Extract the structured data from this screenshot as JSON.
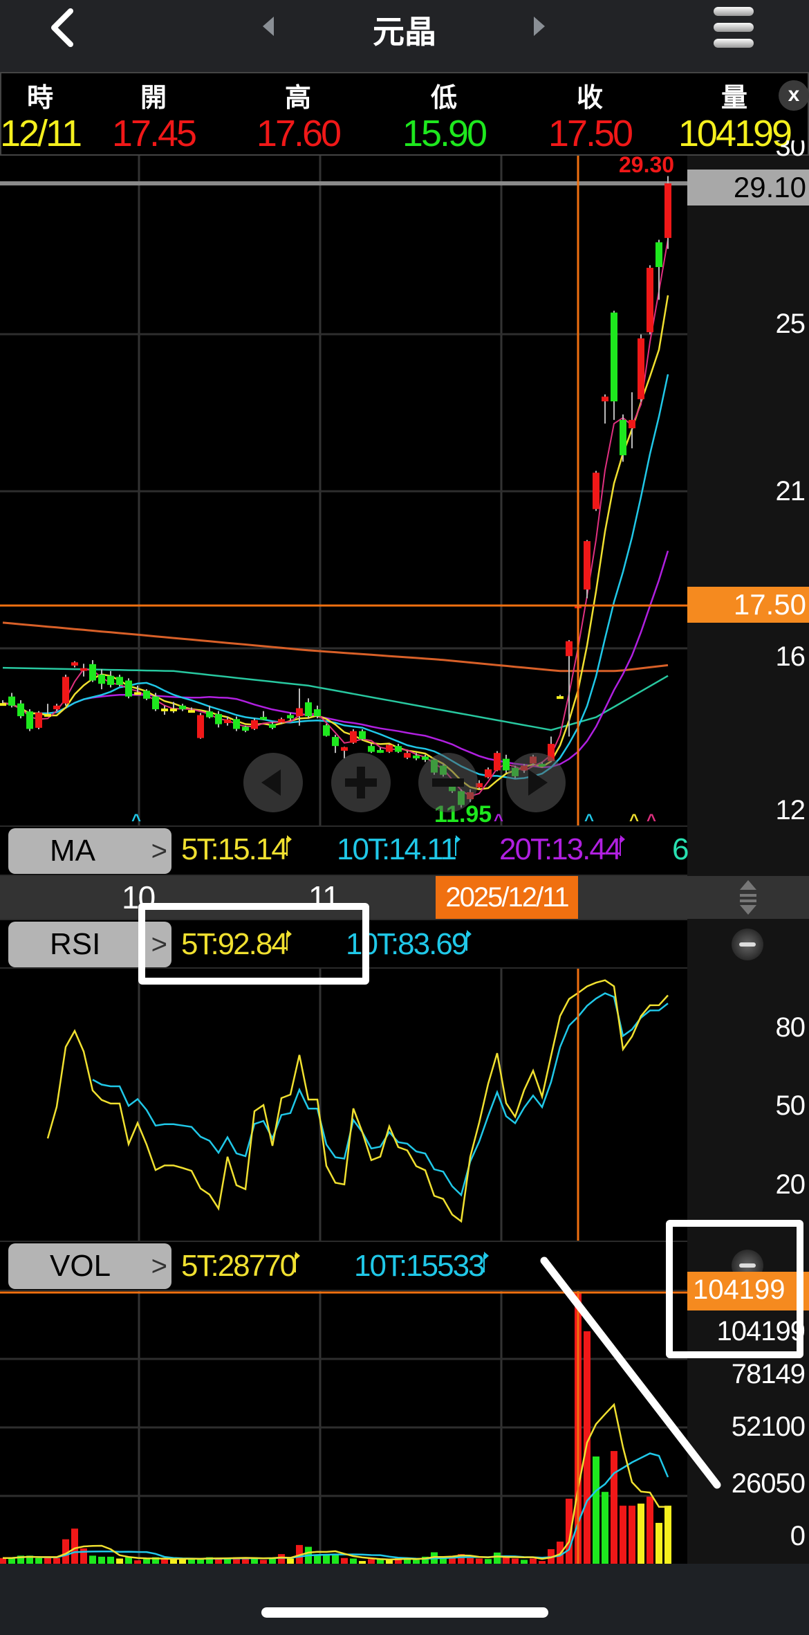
{
  "header": {
    "title": "元晶",
    "back_icon": "chevron-left-icon",
    "prev_icon": "triangle-left-icon",
    "next_icon": "triangle-right-icon",
    "menu_icon": "hamburger-icon"
  },
  "quote": {
    "columns": [
      {
        "label": "時",
        "value": "12/11",
        "color": "#f5f01e"
      },
      {
        "label": "開",
        "value": "17.45",
        "color": "#f01818"
      },
      {
        "label": "高",
        "value": "17.60",
        "color": "#f01818"
      },
      {
        "label": "低",
        "value": "15.90",
        "color": "#1ee81e"
      },
      {
        "label": "收",
        "value": "17.50",
        "color": "#f01818"
      },
      {
        "label": "量",
        "value": "104199",
        "color": "#f5f01e"
      }
    ],
    "close_label": "x"
  },
  "price_axis": {
    "top_partial": "30",
    "last_price": "29.10",
    "ticks": [
      "25",
      "21",
      "16",
      "12"
    ],
    "cursor_price": "17.50",
    "high_label": "29.30",
    "low_label": "11.95"
  },
  "ma_bar": {
    "button": "MA",
    "chevron": ">",
    "values": [
      "5T:15.14",
      "10T:14.11",
      "20T:13.44",
      "6"
    ]
  },
  "date_axis": {
    "ticks": [
      "10",
      "11"
    ],
    "cursor_date": "2025/12/11"
  },
  "rsi_bar": {
    "button": "RSI",
    "chevron": ">",
    "values": [
      "5T:92.84",
      "10T:83.69"
    ],
    "axis": [
      "80",
      "50",
      "20"
    ]
  },
  "vol_bar": {
    "button": "VOL",
    "chevron": ">",
    "values": [
      "5T:28770",
      "10T:15533"
    ],
    "cursor_value": "104199",
    "axis": [
      "104199",
      "78149",
      "52100",
      "26050",
      "0"
    ]
  },
  "colors": {
    "up": "#f01818",
    "down": "#1ee81e",
    "flat": "#f5f01e",
    "ma5": "#f0e030",
    "ma10": "#20c8e8",
    "ma20": "#b020e0",
    "ma60": "#28c8a0",
    "ma_long": "#d86028",
    "ma3": "#e03080",
    "cursor": "#f07010"
  },
  "chart_data": {
    "type": "candlestick",
    "title": "元晶",
    "cursor_index": 64,
    "ohlc": [
      [
        14.82,
        14.9,
        14.75,
        14.82
      ],
      [
        15.0,
        15.1,
        14.7,
        14.75
      ],
      [
        14.81,
        14.9,
        14.4,
        14.46
      ],
      [
        14.59,
        14.65,
        14.05,
        14.11
      ],
      [
        14.14,
        14.6,
        14.1,
        14.56
      ],
      [
        14.52,
        14.8,
        14.45,
        14.52
      ],
      [
        14.65,
        14.8,
        14.6,
        14.75
      ],
      [
        14.81,
        15.6,
        14.75,
        15.54
      ],
      [
        15.85,
        15.97,
        15.8,
        15.94
      ],
      [
        15.74,
        15.9,
        15.55,
        15.78
      ],
      [
        15.89,
        16.0,
        15.4,
        15.44
      ],
      [
        15.6,
        15.75,
        15.2,
        15.35
      ],
      [
        15.57,
        15.7,
        15.25,
        15.32
      ],
      [
        15.54,
        15.6,
        15.28,
        15.32
      ],
      [
        15.44,
        15.5,
        14.95,
        15.0
      ],
      [
        15.12,
        15.3,
        15.05,
        15.12
      ],
      [
        15.16,
        15.2,
        14.9,
        14.94
      ],
      [
        15.0,
        15.1,
        14.6,
        14.65
      ],
      [
        14.67,
        14.75,
        14.5,
        14.67
      ],
      [
        14.67,
        14.85,
        14.55,
        14.67
      ],
      [
        14.75,
        14.8,
        14.6,
        14.65
      ],
      [
        14.63,
        14.7,
        14.6,
        14.63
      ],
      [
        13.86,
        14.55,
        13.84,
        14.49
      ],
      [
        14.59,
        14.75,
        14.4,
        14.43
      ],
      [
        14.52,
        14.6,
        14.15,
        14.24
      ],
      [
        14.27,
        14.45,
        14.2,
        14.37
      ],
      [
        14.38,
        14.45,
        14.05,
        14.11
      ],
      [
        14.17,
        14.2,
        14.02,
        14.06
      ],
      [
        14.11,
        14.4,
        14.08,
        14.35
      ],
      [
        14.44,
        14.6,
        14.35,
        14.38
      ],
      [
        14.24,
        14.3,
        14.1,
        14.14
      ],
      [
        14.29,
        14.42,
        14.25,
        14.38
      ],
      [
        14.49,
        14.55,
        14.35,
        14.4
      ],
      [
        14.46,
        15.22,
        14.2,
        14.68
      ],
      [
        14.84,
        14.95,
        14.4,
        14.46
      ],
      [
        14.65,
        14.75,
        14.4,
        14.46
      ],
      [
        14.21,
        14.25,
        13.9,
        13.92
      ],
      [
        13.89,
        13.95,
        13.45,
        13.64
      ],
      [
        13.51,
        13.62,
        13.3,
        13.61
      ],
      [
        13.73,
        14.1,
        13.7,
        14.05
      ],
      [
        14.05,
        14.1,
        13.8,
        13.83
      ],
      [
        13.64,
        13.7,
        13.45,
        13.48
      ],
      [
        13.53,
        13.6,
        13.45,
        13.5
      ],
      [
        13.48,
        13.7,
        13.45,
        13.67
      ],
      [
        13.64,
        13.7,
        13.45,
        13.48
      ],
      [
        13.32,
        13.5,
        13.28,
        13.45
      ],
      [
        13.38,
        13.45,
        13.25,
        13.3
      ],
      [
        13.35,
        13.4,
        13.2,
        13.26
      ],
      [
        13.26,
        13.3,
        12.85,
        12.91
      ],
      [
        13.1,
        13.15,
        12.8,
        12.85
      ],
      [
        12.56,
        12.65,
        12.35,
        12.4
      ],
      [
        12.4,
        12.45,
        11.95,
        12.02
      ],
      [
        12.18,
        12.45,
        12.1,
        12.37
      ],
      [
        12.5,
        12.7,
        12.45,
        12.62
      ],
      [
        12.78,
        13.05,
        12.75,
        13.0
      ],
      [
        12.97,
        13.5,
        12.95,
        13.45
      ],
      [
        13.29,
        13.4,
        12.9,
        12.97
      ],
      [
        13.04,
        13.1,
        12.75,
        12.81
      ],
      [
        12.97,
        13.15,
        12.9,
        13.1
      ],
      [
        13.16,
        13.4,
        13.1,
        13.35
      ],
      [
        13.15,
        13.2,
        13.1,
        13.13
      ],
      [
        13.23,
        13.9,
        13.2,
        13.7
      ],
      [
        15.01,
        15.05,
        14.98,
        15.01
      ],
      [
        16.11,
        16.55,
        13.9,
        16.52
      ],
      [
        17.45,
        17.6,
        15.9,
        17.5
      ],
      [
        17.94,
        19.3,
        17.7,
        19.27
      ],
      [
        20.15,
        21.2,
        20.1,
        21.15
      ],
      [
        23.11,
        23.3,
        22.5,
        23.24
      ],
      [
        25.55,
        25.6,
        22.6,
        23.11
      ],
      [
        22.6,
        22.75,
        21.45,
        21.63
      ],
      [
        22.37,
        23.36,
        21.82,
        22.6
      ],
      [
        23.17,
        24.95,
        23.1,
        24.84
      ],
      [
        25.01,
        26.85,
        24.95,
        26.78
      ],
      [
        27.48,
        27.55,
        25.9,
        26.8
      ],
      [
        27.6,
        29.3,
        27.3,
        29.1
      ]
    ],
    "volume": [
      2200,
      2200,
      3100,
      3100,
      2200,
      2200,
      2200,
      9400,
      13500,
      5900,
      3100,
      2700,
      2700,
      2000,
      2500,
      1300,
      1800,
      2500,
      1800,
      1800,
      1600,
      2000,
      2200,
      2500,
      2000,
      1800,
      2500,
      2500,
      2200,
      1500,
      2000,
      3700,
      2000,
      7200,
      6500,
      3500,
      3500,
      3400,
      2200,
      2000,
      1050,
      1800,
      1800,
      1500,
      2500,
      1800,
      1500,
      2700,
      4400,
      2500,
      2700,
      3700,
      2200,
      2000,
      1800,
      4300,
      2700,
      2000,
      1500,
      2000,
      1050,
      5600,
      8500,
      25000,
      104199,
      89300,
      41200,
      27600,
      43300,
      22300,
      22300,
      23100,
      25800,
      15700,
      22300
    ],
    "volume_colors": "rggggrrrrrgggygrggryygggrgrrgrgryrggggrgyrgyrgggggrrrrggrrgrrrrrrrggrrryr",
    "ma_long_anchors": [
      [
        0,
        17.03
      ],
      [
        14.5,
        16.71
      ],
      [
        34,
        16.27
      ],
      [
        48.8,
        16.01
      ],
      [
        62,
        15.7
      ],
      [
        68.4,
        15.7
      ],
      [
        74,
        15.86
      ]
    ],
    "ma60_anchors": [
      [
        0,
        15.79
      ],
      [
        19,
        15.7
      ],
      [
        34,
        15.3
      ],
      [
        49,
        14.62
      ],
      [
        61,
        14.08
      ],
      [
        66,
        14.43
      ],
      [
        74,
        15.57
      ]
    ],
    "price_range": [
      11.5,
      30
    ],
    "rsi_range": [
      0,
      100
    ],
    "volume_range": [
      0,
      104199
    ]
  }
}
